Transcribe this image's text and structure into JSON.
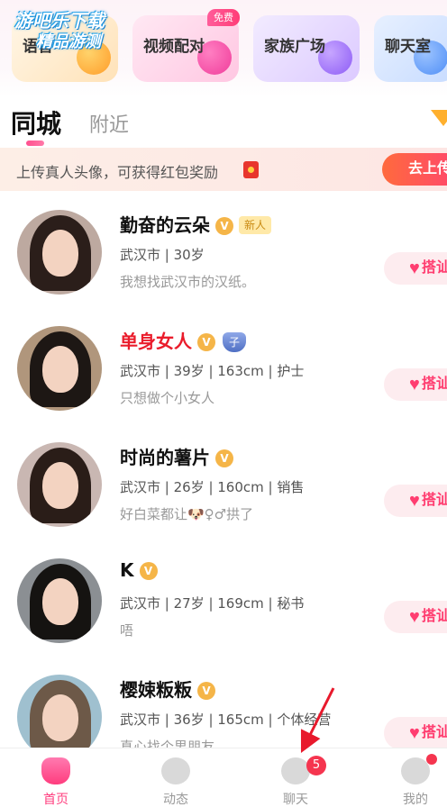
{
  "watermark": {
    "line1": "游吧乐下载",
    "line2": "精品游测"
  },
  "features": {
    "cards": [
      {
        "label": "语音"
      },
      {
        "label": "视频配对"
      },
      {
        "label": "家族广场"
      },
      {
        "label": "聊天室"
      }
    ],
    "free_badge": "免费"
  },
  "tabs": {
    "active": "同城",
    "inactive": "附近"
  },
  "banner": {
    "text": "上传真人头像，可获得红包奖励",
    "button": "去上传"
  },
  "users": [
    {
      "name": "勤奋的云朵",
      "tag": "新人",
      "info": "武汉市 | 30岁",
      "bio": "我想找武汉市的汉纸。"
    },
    {
      "name": "单身女人",
      "shield": "子",
      "info": "武汉市 | 39岁 | 163cm | 护士",
      "bio": "只想做个小女人"
    },
    {
      "name": "时尚的薯片",
      "info": "武汉市 | 26岁 | 160cm | 销售",
      "bio": "好白菜都让🐶♀♂拱了"
    },
    {
      "name": "K",
      "info": "武汉市 | 27岁 | 169cm | 秘书",
      "bio": "唔"
    },
    {
      "name": "樱娕粄粄",
      "info": "武汉市 | 36岁 | 165cm | 个体经营",
      "bio": "真心找个男朋友"
    }
  ],
  "hello_label": "搭讪",
  "verified_glyph": "V",
  "nav": {
    "home": "首页",
    "dynamic": "动态",
    "chat": "聊天",
    "chat_badge": "5",
    "mine": "我的"
  },
  "colors": {
    "accent": "#ff3d70",
    "verified": "#f5b548",
    "banner_button": "#ff5a55",
    "annotation_arrow": "#e8192c"
  }
}
